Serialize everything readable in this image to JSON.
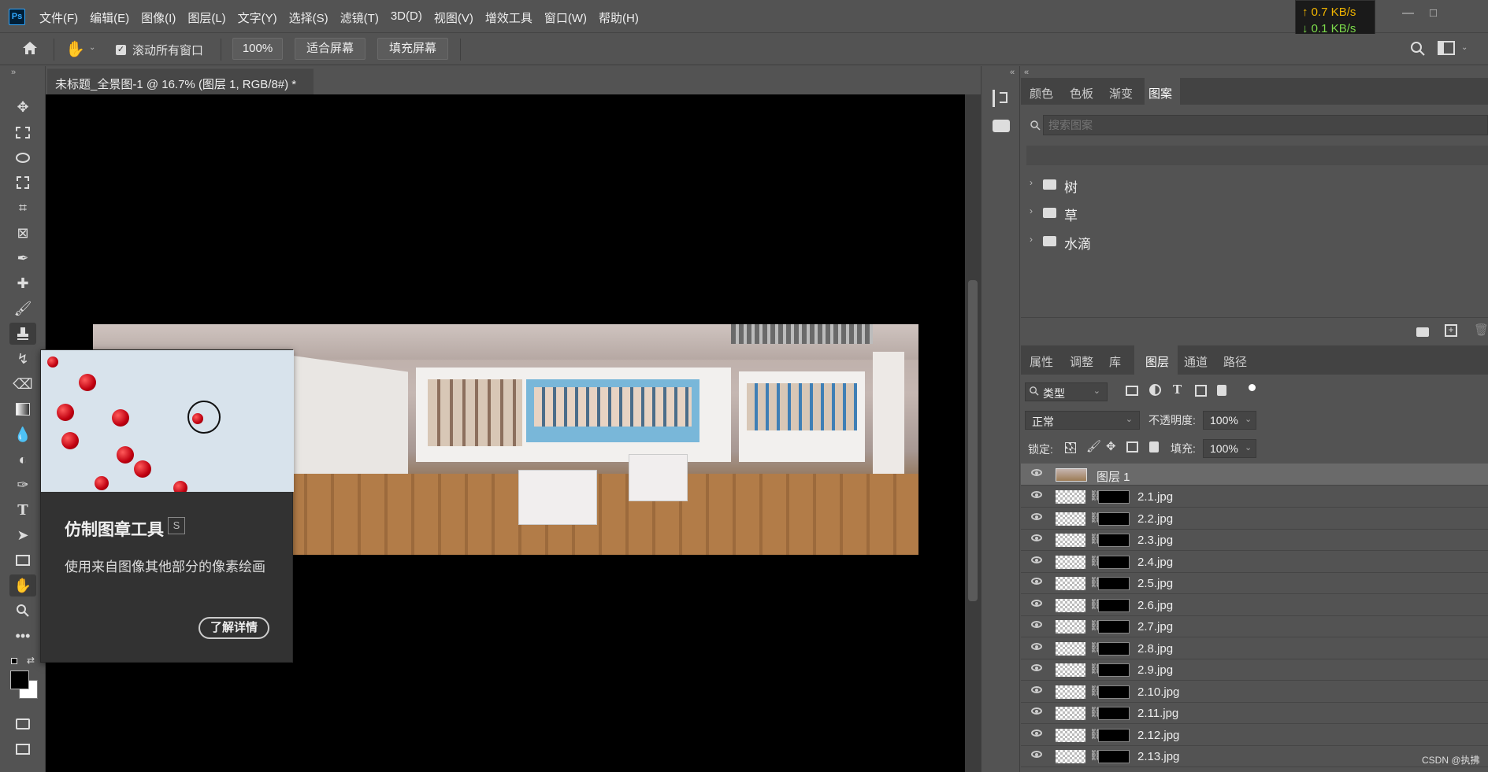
{
  "app": {
    "logo_text": "Ps"
  },
  "menu": [
    "文件(F)",
    "编辑(E)",
    "图像(I)",
    "图层(L)",
    "文字(Y)",
    "选择(S)",
    "滤镜(T)",
    "3D(D)",
    "视图(V)",
    "增效工具",
    "窗口(W)",
    "帮助(H)"
  ],
  "netspeed": {
    "up": "↑ 0.7 KB/s",
    "down": "↓ 0.1 KB/s"
  },
  "window_controls": {
    "minimize": "—",
    "maximize": "□"
  },
  "options": {
    "scroll_all_label": "滚动所有窗口",
    "scroll_all_checked": true,
    "zoom_value": "100%",
    "fit_screen": "适合屏幕",
    "fill_screen": "填充屏幕"
  },
  "document": {
    "tab_title": "未标题_全景图-1 @ 16.7% (图层 1, RGB/8#) *",
    "close": "×"
  },
  "tooltip": {
    "title": "仿制图章工具",
    "shortcut": "S",
    "description": "使用来自图像其他部分的像素绘画",
    "learn_more": "了解详情"
  },
  "pattern_panel": {
    "tabs": [
      "颜色",
      "色板",
      "渐变",
      "图案"
    ],
    "active_tab": "图案",
    "search_placeholder": "搜索图案",
    "folders": [
      "树",
      "草",
      "水滴"
    ]
  },
  "layer_panel": {
    "tabs": [
      "属性",
      "调整",
      "库",
      "图层",
      "通道",
      "路径"
    ],
    "active_tab": "图层",
    "filter_label": "类型",
    "blend_mode": "正常",
    "opacity_label": "不透明度:",
    "opacity_value": "100%",
    "lock_label": "锁定:",
    "fill_label": "填充:",
    "fill_value": "100%",
    "layers": [
      {
        "name": "图层 1"
      },
      {
        "name": "2.1.jpg"
      },
      {
        "name": "2.2.jpg"
      },
      {
        "name": "2.3.jpg"
      },
      {
        "name": "2.4.jpg"
      },
      {
        "name": "2.5.jpg"
      },
      {
        "name": "2.6.jpg"
      },
      {
        "name": "2.7.jpg"
      },
      {
        "name": "2.8.jpg"
      },
      {
        "name": "2.9.jpg"
      },
      {
        "name": "2.10.jpg"
      },
      {
        "name": "2.11.jpg"
      },
      {
        "name": "2.12.jpg"
      },
      {
        "name": "2.13.jpg"
      }
    ]
  },
  "watermark": "CSDN @执拂",
  "colors": {
    "accent": "#31a8ff",
    "panel_bg": "#535353",
    "canvas": "#000000"
  }
}
